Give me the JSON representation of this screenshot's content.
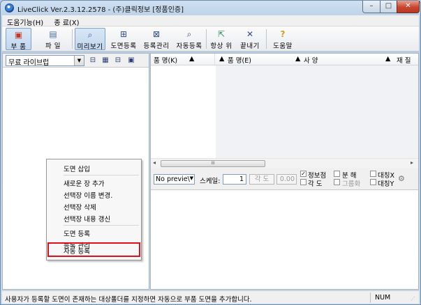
{
  "window": {
    "title": "LiveClick Ver.2.3.12.2578 - (주)클릭정보 [정품인증]",
    "minimize": "–",
    "maximize": "□",
    "close": "✕"
  },
  "menu": [
    "도움기능(H)",
    "종 료(X)"
  ],
  "toolbar": [
    {
      "label": "부 품",
      "icon": "parts-icon",
      "glyph": "▣",
      "color": "#c0392b"
    },
    {
      "label": "파 일",
      "icon": "file-icon",
      "glyph": "▤",
      "color": "#4a6fa5"
    },
    {
      "label": "미리보기",
      "icon": "magnifier-icon",
      "glyph": "⌕",
      "color": "#2d5a9a"
    },
    {
      "label": "도면등록",
      "icon": "drawing-register-icon",
      "glyph": "⊞",
      "color": "#2f4c8a"
    },
    {
      "label": "등록관리",
      "icon": "registration-manage-icon",
      "glyph": "⊠",
      "color": "#2f4c8a"
    },
    {
      "label": "자동등록",
      "icon": "auto-register-icon",
      "glyph": "⌕",
      "color": "#2f4c8a"
    },
    {
      "label": "항상 위",
      "icon": "always-on-top-icon",
      "glyph": "⇱",
      "color": "#2e8b57"
    },
    {
      "label": "끝내기",
      "icon": "exit-icon",
      "glyph": "✕",
      "color": "#2f4c8a"
    },
    {
      "label": "도움말",
      "icon": "help-icon",
      "glyph": "?",
      "color": "#d4a017"
    }
  ],
  "library": {
    "selected": "무료 라이브럽"
  },
  "columns": [
    "품 명(K)",
    "품 명(E)",
    "사 양",
    "재 질"
  ],
  "context_menu": {
    "items": [
      "도면 삽입",
      "새로운 장 추가",
      "선택장 이름 변경.",
      "선택장 삭제",
      "선택장 내용 갱신",
      "도면 등록",
      "등록 관리",
      "자동 등록"
    ],
    "highlighted": "자동 등록"
  },
  "scrollbar": {
    "thumb_grip": "III"
  },
  "properties": {
    "preview_select": "No previe\\",
    "scale_label": "스케일:",
    "scale_value": "1",
    "angle_label": "각 도",
    "angle_value": "0.00",
    "info_point": "정보점",
    "angle2": "각 도",
    "explode": "분 해",
    "group": "그룹화",
    "symmetry_x": "대칭X",
    "symmetry_y": "대칭Y"
  },
  "status": {
    "message": "사용자가 등록할 도면이 존재하는 대상폴더를 지정하면 자동으로 부품 도면을 추가합니다.",
    "num": "NUM"
  },
  "colors": {
    "highlight_border": "#e0101a",
    "titlebar": "#b9cfe6"
  }
}
